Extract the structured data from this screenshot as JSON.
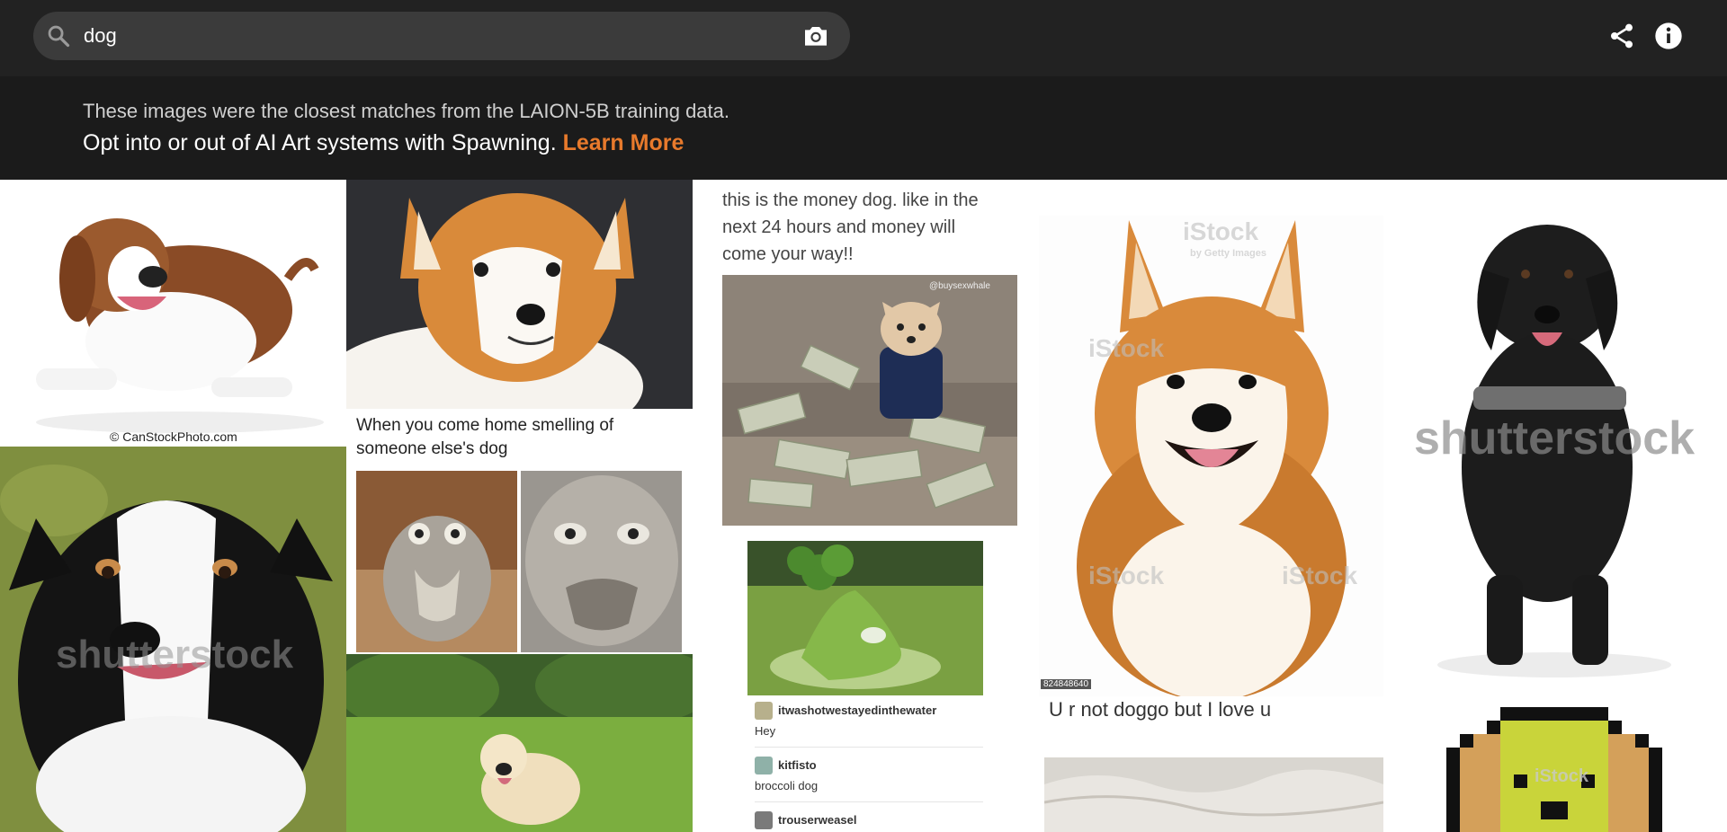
{
  "search": {
    "query": "dog",
    "placeholder": ""
  },
  "icons": {
    "search": "search-icon",
    "camera": "camera-icon",
    "share": "share-icon",
    "info": "info-icon"
  },
  "banner": {
    "line1": "These images were the closest matches from the LAION-5B training data.",
    "line2": "Opt into or out of AI Art systems with Spawning.",
    "learn_more": "Learn More"
  },
  "colors": {
    "accent": "#e87a2c",
    "topbar": "#222222",
    "search_bg": "#3b3b3b",
    "banner_bg": "#1b1b1b"
  },
  "results": {
    "beagle": {
      "caption": "© CanStockPhoto.com"
    },
    "corgi_meme": {
      "caption": "When you come home smelling of someone else's dog"
    },
    "money_dog": {
      "caption": "this is the money dog. like in the next 24 hours and money will come your way!!",
      "image_label": "@buysexwhale"
    },
    "broccoli_post": {
      "comments": [
        {
          "user": "itwashotwestayedinthewater",
          "text": "Hey"
        },
        {
          "user": "kitfisto",
          "text": "broccoli dog"
        },
        {
          "user": "trouserweasel",
          "text": ""
        }
      ]
    },
    "shiba": {
      "watermark": "iStock",
      "watermark_sub": "by Getty Images",
      "stock_id": "824848640"
    },
    "shiba_meme": {
      "caption": "U r not doggo but I love u"
    },
    "aussie": {
      "watermark": "shutterstock"
    },
    "lab": {
      "watermark": "shutterstock"
    },
    "pixel_dog": {
      "watermark": "iStock"
    }
  }
}
